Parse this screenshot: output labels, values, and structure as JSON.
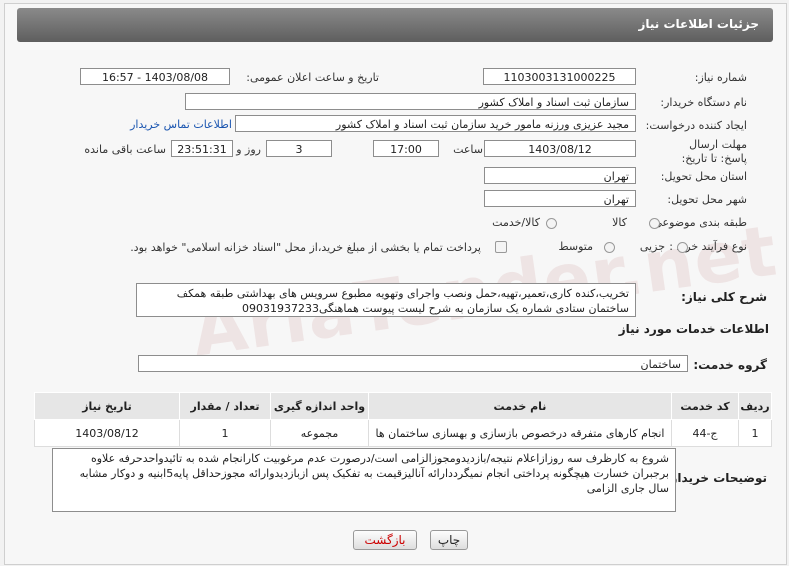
{
  "header": {
    "title": "جزئیات اطلاعات نیاز"
  },
  "fields": {
    "need_number_label": "شماره نیاز:",
    "need_number": "1103003131000225",
    "announce_label": "تاریخ و ساعت اعلان عمومی:",
    "announce_value": "1403/08/08 - 16:57",
    "buyer_org_label": "نام دستگاه خریدار:",
    "buyer_org": "سازمان ثبت اسناد و املاک کشور",
    "creator_label": "ایجاد کننده درخواست:",
    "creator": "مجید عزیزی ورزنه مامور خرید سازمان ثبت اسناد و املاک کشور",
    "contact_link": "اطلاعات تماس خریدار",
    "deadline_label": "مهلت ارسال پاسخ: تا تاریخ:",
    "deadline_date": "1403/08/12",
    "time_label": "ساعت",
    "deadline_time": "17:00",
    "days_value": "3",
    "days_label": "روز و",
    "remaining_time": "23:51:31",
    "remaining_label": "ساعت باقی مانده",
    "province_label": "استان محل تحویل:",
    "province": "تهران",
    "city_label": "شهر محل تحویل:",
    "city": "تهران",
    "category_label": "طبقه بندی موضوعی:",
    "category_goods": "کالا",
    "category_service": "کالا/خدمت",
    "process_label": "نوع فرآیند خرید :",
    "process_minor": "جزیی",
    "process_medium": "متوسط",
    "payment_note": "پرداخت تمام یا بخشی از مبلغ خرید،از محل \"اسناد خزانه اسلامی\" خواهد بود."
  },
  "summary": {
    "label": "شرح کلی نیاز:",
    "text": "تخریب،کنده کاری،تعمیر،تهیه،حمل ونصب واجرای وتهویه مطبوع سرویس های بهداشتی طبقه همکف ساختمان ستادی شماره یک سازمان به شرح لیست پیوست هماهنگی09031937233"
  },
  "services": {
    "section_title": "اطلاعات خدمات مورد نیاز",
    "group_label": "گروه خدمت:",
    "group_value": "ساختمان",
    "columns": [
      "ردیف",
      "کد خدمت",
      "نام خدمت",
      "واحد اندازه گیری",
      "تعداد / مقدار",
      "تاریخ نیاز"
    ],
    "rows": [
      [
        "1",
        "ج-44",
        "انجام کارهای متفرقه درخصوص بازسازی و بهسازی ساختمان ها",
        "مجموعه",
        "1",
        "1403/08/12"
      ]
    ]
  },
  "buyer_notes": {
    "label": "توضیحات خریدار:",
    "text": "شروع به کارظرف سه روزازاعلام نتیجه/بازدیدومجوزالزامی است/درصورت عدم مرغوبیت کارانجام شده به تائیدواحدحرفه علاوه برجبران خسارت هیچگونه پرداختی انجام نمیگرددارائه آنالیزقیمت به تفکیک پس ازبازدیدوارائه مجوزحداقل پایه5ابنیه و دوکار مشابه سال جاری الزامی"
  },
  "buttons": {
    "print": "چاپ",
    "back": "بازگشت"
  },
  "watermark": "AriaTender.net",
  "colors": {
    "header_bg": "#6e6e6e",
    "link": "#1a55b0"
  }
}
